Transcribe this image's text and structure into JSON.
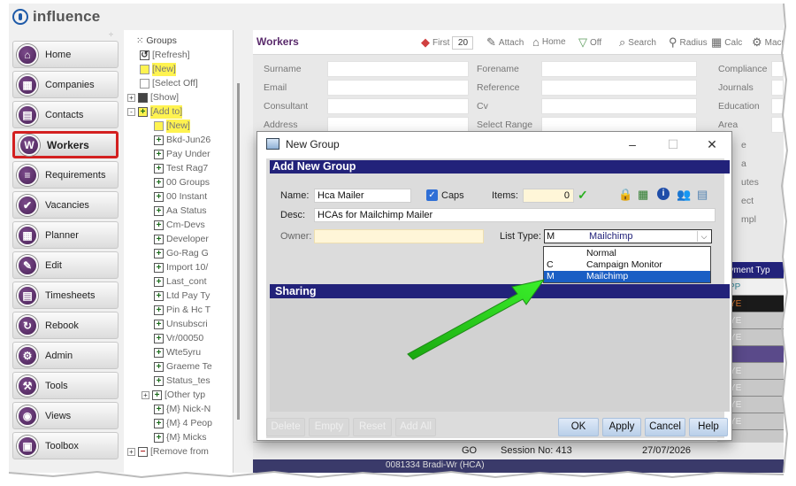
{
  "app": {
    "brand": "influence"
  },
  "sidebar": {
    "items": [
      {
        "label": "Home",
        "icon": "home-icon",
        "glyph": "⌂"
      },
      {
        "label": "Companies",
        "icon": "building-icon",
        "glyph": "▦"
      },
      {
        "label": "Contacts",
        "icon": "contact-card-icon",
        "glyph": "▤"
      },
      {
        "label": "Workers",
        "icon": "workers-icon",
        "glyph": "W",
        "active": true
      },
      {
        "label": "Requirements",
        "icon": "list-icon",
        "glyph": "≡"
      },
      {
        "label": "Vacancies",
        "icon": "vacancy-icon",
        "glyph": "✔"
      },
      {
        "label": "Planner",
        "icon": "planner-icon",
        "glyph": "▦"
      },
      {
        "label": "Edit",
        "icon": "edit-icon",
        "glyph": "✎"
      },
      {
        "label": "Timesheets",
        "icon": "timesheet-icon",
        "glyph": "▤"
      },
      {
        "label": "Rebook",
        "icon": "rebook-icon",
        "glyph": "↻"
      },
      {
        "label": "Admin",
        "icon": "admin-icon",
        "glyph": "⚙"
      },
      {
        "label": "Tools",
        "icon": "tools-icon",
        "glyph": "⚒"
      },
      {
        "label": "Views",
        "icon": "eye-icon",
        "glyph": "◉"
      },
      {
        "label": "Toolbox",
        "icon": "toolbox-icon",
        "glyph": "▣"
      }
    ]
  },
  "tree": {
    "title": "Groups",
    "nodes": [
      {
        "label": "[Refresh]",
        "indent": 0,
        "box": "refresh",
        "highlight": false
      },
      {
        "label": "[New]",
        "indent": 0,
        "box": "empty",
        "highlight": true
      },
      {
        "label": "[Select Off]",
        "indent": 0,
        "box": "empty",
        "highlight": false
      },
      {
        "label": "[Show]",
        "indent": 0,
        "box": "filled",
        "highlight": false,
        "expand": "+"
      },
      {
        "label": "[Add to]",
        "indent": 0,
        "box": "plus",
        "highlight": true,
        "expand": "-"
      },
      {
        "label": "[New]",
        "indent": 1,
        "box": "empty",
        "highlight": true
      },
      {
        "label": "Bkd-Jun26",
        "indent": 1,
        "box": "plus"
      },
      {
        "label": "Pay Under",
        "indent": 1,
        "box": "plus"
      },
      {
        "label": "Test Rag7",
        "indent": 1,
        "box": "plus"
      },
      {
        "label": "00 Groups",
        "indent": 1,
        "box": "plus"
      },
      {
        "label": "00 Instant",
        "indent": 1,
        "box": "plus"
      },
      {
        "label": "Aa Status",
        "indent": 1,
        "box": "plus"
      },
      {
        "label": "Cm-Devs",
        "indent": 1,
        "box": "plus"
      },
      {
        "label": "Developer",
        "indent": 1,
        "box": "plus"
      },
      {
        "label": "Go-Rag G",
        "indent": 1,
        "box": "plus"
      },
      {
        "label": "Import 10/",
        "indent": 1,
        "box": "plus"
      },
      {
        "label": "Last_cont",
        "indent": 1,
        "box": "plus"
      },
      {
        "label": "Ltd Pay Ty",
        "indent": 1,
        "box": "plus"
      },
      {
        "label": "Pin & Hc T",
        "indent": 1,
        "box": "plus"
      },
      {
        "label": "Unsubscri",
        "indent": 1,
        "box": "plus"
      },
      {
        "label": "Vr/00050",
        "indent": 1,
        "box": "plus"
      },
      {
        "label": "Wte5yru",
        "indent": 1,
        "box": "plus"
      },
      {
        "label": "Graeme Te",
        "indent": 1,
        "box": "plus"
      },
      {
        "label": "Status_tes",
        "indent": 1,
        "box": "plus"
      },
      {
        "label": "[Other typ",
        "indent": 1,
        "box": "plus",
        "expand": "+"
      },
      {
        "label": "{M} Nick-N",
        "indent": 1,
        "box": "plus"
      },
      {
        "label": "{M} 4 Peop",
        "indent": 1,
        "box": "plus"
      },
      {
        "label": "{M} Micks",
        "indent": 1,
        "box": "plus"
      },
      {
        "label": "[Remove from",
        "indent": 0,
        "box": "minus",
        "expand": "+"
      }
    ]
  },
  "main": {
    "title": "Workers",
    "toolbar": {
      "first_label": "First",
      "first_value": "20",
      "attach": "Attach",
      "home": "Home",
      "off": "Off",
      "search": "Search",
      "radius": "Radius",
      "calc": "Calc",
      "macro": "Macr"
    },
    "filters": {
      "col1": [
        "Surname",
        "Email",
        "Consultant",
        "Address"
      ],
      "col2": [
        "Forename",
        "Reference",
        "Cv",
        "Select Range"
      ],
      "col3": [
        "Compliance",
        "Journals",
        "Education",
        "Area"
      ],
      "col3_partial": [
        "e",
        "a",
        "utes",
        "ect",
        "mpl"
      ],
      "col1_partial": [
        "S",
        "S",
        "R",
        "C",
        "P"
      ]
    },
    "grid_header": "ayment Typ",
    "grid_rows": [
      "JPP",
      "AYE",
      "AYE",
      "AYE",
      "D",
      "AYE",
      "AYE",
      "AYE",
      "AYE",
      "D",
      "AYE",
      "AYE",
      "AYE"
    ],
    "status": {
      "go": "GO",
      "session": "Session No: 413",
      "date": "27/07/2026"
    },
    "bottom_partial": "0081334 Bradi-Wr (HCA)"
  },
  "dialog": {
    "title": "New Group",
    "header": "Add New Group",
    "name_label": "Name:",
    "name_value": "Hca Mailer",
    "caps_label": "Caps",
    "caps_checked": true,
    "items_label": "Items:",
    "items_value": "0",
    "desc_label": "Desc:",
    "desc_value": "HCAs for Mailchimp Mailer",
    "owner_label": "Owner:",
    "owner_value": "",
    "list_type_label": "List Type:",
    "list_type_code": "M",
    "list_type_value": "Mailchimp",
    "list_type_options": [
      {
        "code": "",
        "label": "Normal"
      },
      {
        "code": "C",
        "label": "Campaign Monitor"
      },
      {
        "code": "M",
        "label": "Mailchimp",
        "selected": true
      }
    ],
    "sharing_header": "Sharing",
    "buttons": {
      "delete": "Delete",
      "empty": "Empty",
      "reset": "Reset",
      "add_all": "Add All",
      "ok": "OK",
      "apply": "Apply",
      "cancel": "Cancel",
      "help": "Help"
    }
  },
  "colors": {
    "accent_purple": "#5a2b6c",
    "header_navy": "#22227a",
    "highlight_yellow": "#fff350",
    "selected_blue": "#1a5ec4",
    "active_outline": "#d32020",
    "arrow_green": "#2bd81e"
  }
}
